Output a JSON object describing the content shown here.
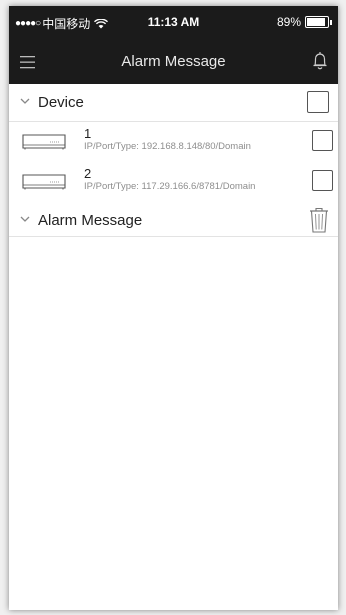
{
  "status_bar": {
    "signal_dots": "●●●●○",
    "carrier": "中国移动",
    "time": "11:13 AM",
    "battery_percent": "89%",
    "battery_level": 0.89
  },
  "nav": {
    "title": "Alarm Message",
    "menu_icon": "hamburger-menu-icon",
    "bell_icon": "bell-icon"
  },
  "device_section": {
    "label": "Device",
    "checked": false,
    "devices": [
      {
        "name": "1",
        "info": "IP/Port/Type: 192.168.8.148/80/Domain",
        "checked": false
      },
      {
        "name": "2",
        "info": "IP/Port/Type: 117.29.166.6/8781/Domain",
        "checked": false
      }
    ]
  },
  "alarm_section": {
    "label": "Alarm Message",
    "delete_icon": "trash-icon"
  },
  "colors": {
    "header_bg": "#1b1b1b",
    "divider": "#e3e3e3",
    "secondary_text": "#8e8e8e"
  }
}
